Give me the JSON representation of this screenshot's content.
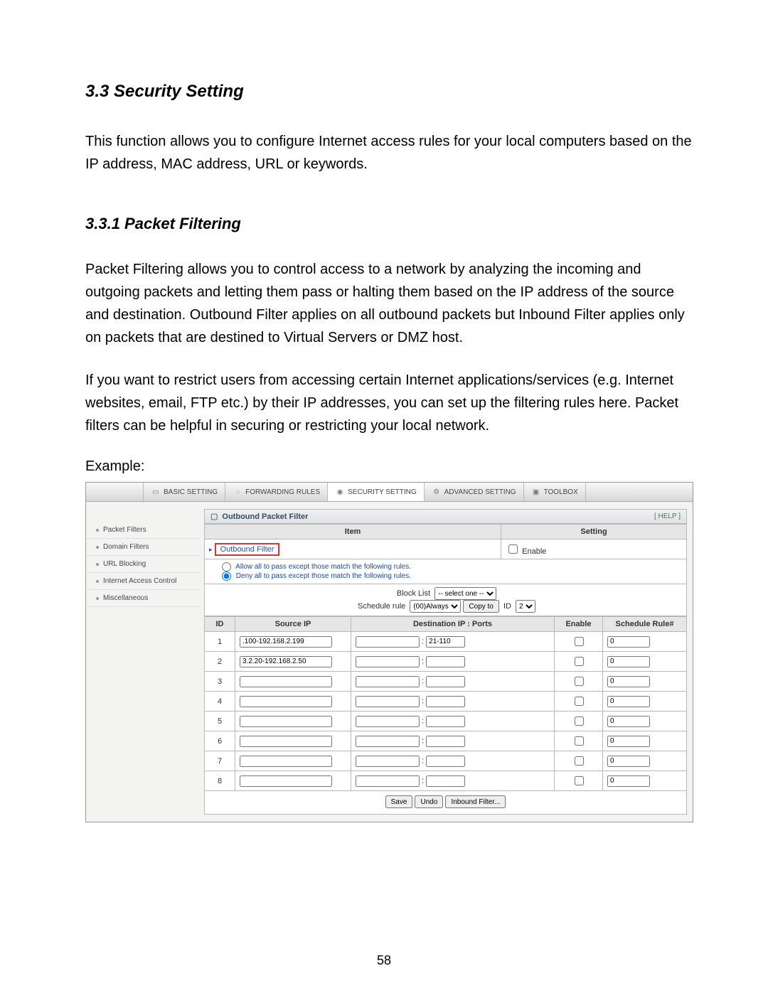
{
  "doc": {
    "heading": "3.3 Security Setting",
    "intro": "This function allows you to configure Internet access rules for your local computers based on the IP address, MAC address, URL or keywords.",
    "sub_heading": "3.3.1 Packet Filtering",
    "para1": "Packet Filtering allows you to control access to a network by analyzing the incoming and outgoing packets and letting them pass or halting them based on the IP address of the source and destination. Outbound Filter applies on all outbound packets but Inbound Filter applies only on packets that are destined to Virtual Servers or DMZ host.",
    "para2": "If you want to restrict users from accessing certain Internet applications/services (e.g. Internet websites, email, FTP etc.) by their IP addresses, you can set up the filtering rules here. Packet filters can be helpful in securing or restricting your local network.",
    "example_label": "Example:",
    "page_number": "58"
  },
  "ui": {
    "tabs": {
      "basic": "BASIC SETTING",
      "forwarding": "FORWARDING RULES",
      "security": "SECURITY SETTING",
      "advanced": "ADVANCED SETTING",
      "toolbox": "TOOLBOX"
    },
    "sidebar": {
      "items": [
        {
          "label": "Packet Filters"
        },
        {
          "label": "Domain Filters"
        },
        {
          "label": "URL Blocking"
        },
        {
          "label": "Internet Access Control"
        },
        {
          "label": "Miscellaneous"
        }
      ]
    },
    "panel": {
      "title": "Outbound Packet Filter",
      "help": "[ HELP ]",
      "item_header": "Item",
      "setting_header": "Setting",
      "outbound_label": "Outbound Filter",
      "enable_label": "Enable",
      "rule_allow": "Allow all to pass except those match the following rules.",
      "rule_deny": "Deny all to pass except those match the following rules.",
      "blocklist_label": "Block List",
      "blocklist_sel": "-- select one --",
      "schedule_label": "Schedule rule",
      "schedule_sel": "(00)Always",
      "copyto_btn": "Copy to",
      "id_label": "ID",
      "id_sel": "2",
      "cols": {
        "id": "ID",
        "src": "Source IP",
        "dst": "Destination IP : Ports",
        "enable": "Enable",
        "srule": "Schedule Rule#"
      },
      "rows": [
        {
          "id": "1",
          "src": ".100-192.168.2.199",
          "dst_ip": "",
          "dst_port": "21-110",
          "enable": false,
          "srule": "0"
        },
        {
          "id": "2",
          "src": "3.2.20-192.168.2.50",
          "dst_ip": "",
          "dst_port": "",
          "enable": false,
          "srule": "0"
        },
        {
          "id": "3",
          "src": "",
          "dst_ip": "",
          "dst_port": "",
          "enable": false,
          "srule": "0"
        },
        {
          "id": "4",
          "src": "",
          "dst_ip": "",
          "dst_port": "",
          "enable": false,
          "srule": "0"
        },
        {
          "id": "5",
          "src": "",
          "dst_ip": "",
          "dst_port": "",
          "enable": false,
          "srule": "0"
        },
        {
          "id": "6",
          "src": "",
          "dst_ip": "",
          "dst_port": "",
          "enable": false,
          "srule": "0"
        },
        {
          "id": "7",
          "src": "",
          "dst_ip": "",
          "dst_port": "",
          "enable": false,
          "srule": "0"
        },
        {
          "id": "8",
          "src": "",
          "dst_ip": "",
          "dst_port": "",
          "enable": false,
          "srule": "0"
        }
      ],
      "buttons": {
        "save": "Save",
        "undo": "Undo",
        "inbound": "Inbound Filter..."
      }
    }
  }
}
